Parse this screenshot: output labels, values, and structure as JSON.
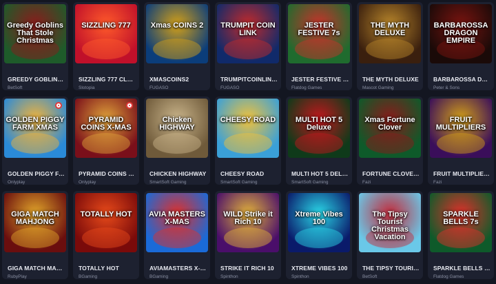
{
  "games": [
    {
      "title": "GREEDY GOBLINS T...",
      "provider": "BetSoft",
      "art": "Greedy Goblins That Stole Christmas",
      "c1": "#1e5b2a",
      "c2": "#8a1c1c"
    },
    {
      "title": "SIZZLING 777 CLAS...",
      "provider": "Slotopia",
      "art": "SIZZLING 777",
      "c1": "#c0102a",
      "c2": "#ff5a2a"
    },
    {
      "title": "XMASCOINS2",
      "provider": "FUGASO",
      "art": "Xmas COINS 2",
      "c1": "#0b3d7a",
      "c2": "#d4a017"
    },
    {
      "title": "TRUMPITCOINLINK...",
      "provider": "FUGASO",
      "art": "TRUMPIT COIN LINK",
      "c1": "#102a6a",
      "c2": "#c42a2a"
    },
    {
      "title": "JESTER FESTIVE 7S",
      "provider": "Flatdog Games",
      "art": "JESTER FESTIVE 7s",
      "c1": "#1f6b2e",
      "c2": "#c8322a"
    },
    {
      "title": "THE MYTH DELUXE",
      "provider": "Mascot Gaming",
      "art": "THE MYTH DELUXE",
      "c1": "#3a1f0e",
      "c2": "#b8862b"
    },
    {
      "title": "BARBAROSSA DRA...",
      "provider": "Peter & Sons",
      "art": "BARBAROSSA DRAGON EMPIRE",
      "c1": "#1a0a08",
      "c2": "#7a1410"
    },
    {
      "title": "GOLDEN PIGGY FAR...",
      "provider": "Onlyplay",
      "art": "GOLDEN PIGGY FARM XMAS",
      "c1": "#2a8ad8",
      "c2": "#f2b33a"
    },
    {
      "title": "PYRAMID COINS X-...",
      "provider": "Onlyplay",
      "art": "PYRAMID COINS X-MAS",
      "c1": "#7a0f1a",
      "c2": "#e0a33a"
    },
    {
      "title": "CHICKEN HIGHWAY",
      "provider": "SmartSoft Gaming",
      "art": "Chicken HIGHWAY",
      "c1": "#6f5a3a",
      "c2": "#c9b48a"
    },
    {
      "title": "CHEESY ROAD",
      "provider": "SmartSoft Gaming",
      "art": "CHEESY ROAD",
      "c1": "#3aa0d8",
      "c2": "#f2c23a"
    },
    {
      "title": "MULTI HOT 5 DELUXE",
      "provider": "SmartSoft Gaming",
      "art": "MULTI HOT 5 Deluxe",
      "c1": "#0f3a1a",
      "c2": "#c4161c"
    },
    {
      "title": "FORTUNE CLOVER ...",
      "provider": "Fazi",
      "art": "Xmas Fortune Clover",
      "c1": "#0e5a2a",
      "c2": "#8a1a1a"
    },
    {
      "title": "FRUIT MULTIPLIERS",
      "provider": "Fazi",
      "art": "FRUIT MULTIPLIERS",
      "c1": "#3a0e5a",
      "c2": "#d4a017"
    },
    {
      "title": "GIGA MATCH MAHJ...",
      "provider": "RubyPlay",
      "art": "GIGA MATCH MAHJONG",
      "c1": "#6a0e0e",
      "c2": "#e2a62a"
    },
    {
      "title": "TOTALLY HOT",
      "provider": "BGaming",
      "art": "TOTALLY HOT",
      "c1": "#7a0a0a",
      "c2": "#e84a1a"
    },
    {
      "title": "AVIAMASTERS X-MAS",
      "provider": "BGaming",
      "art": "AVIA MASTERS X-MAS",
      "c1": "#1a6ad8",
      "c2": "#e0302a"
    },
    {
      "title": "STRIKE IT RICH 10",
      "provider": "Spinthon",
      "art": "WILD Strike it Rich 10",
      "c1": "#4a0e6a",
      "c2": "#e2b23a"
    },
    {
      "title": "XTREME VIBES 100",
      "provider": "Spinthon",
      "art": "Xtreme Vibes 100",
      "c1": "#0a1a6a",
      "c2": "#2ad8e8"
    },
    {
      "title": "THE TIPSY TOURIST...",
      "provider": "BetSoft",
      "art": "The Tipsy Tourist Christmas Vacation",
      "c1": "#6ac8e8",
      "c2": "#c42a3a"
    },
    {
      "title": "SPARKLE BELLS 7S",
      "provider": "Flatdog Games",
      "art": "SPARKLE BELLS 7s",
      "c1": "#0e5a2a",
      "c2": "#e0302a"
    }
  ],
  "fav_badges": [
    7,
    8
  ]
}
